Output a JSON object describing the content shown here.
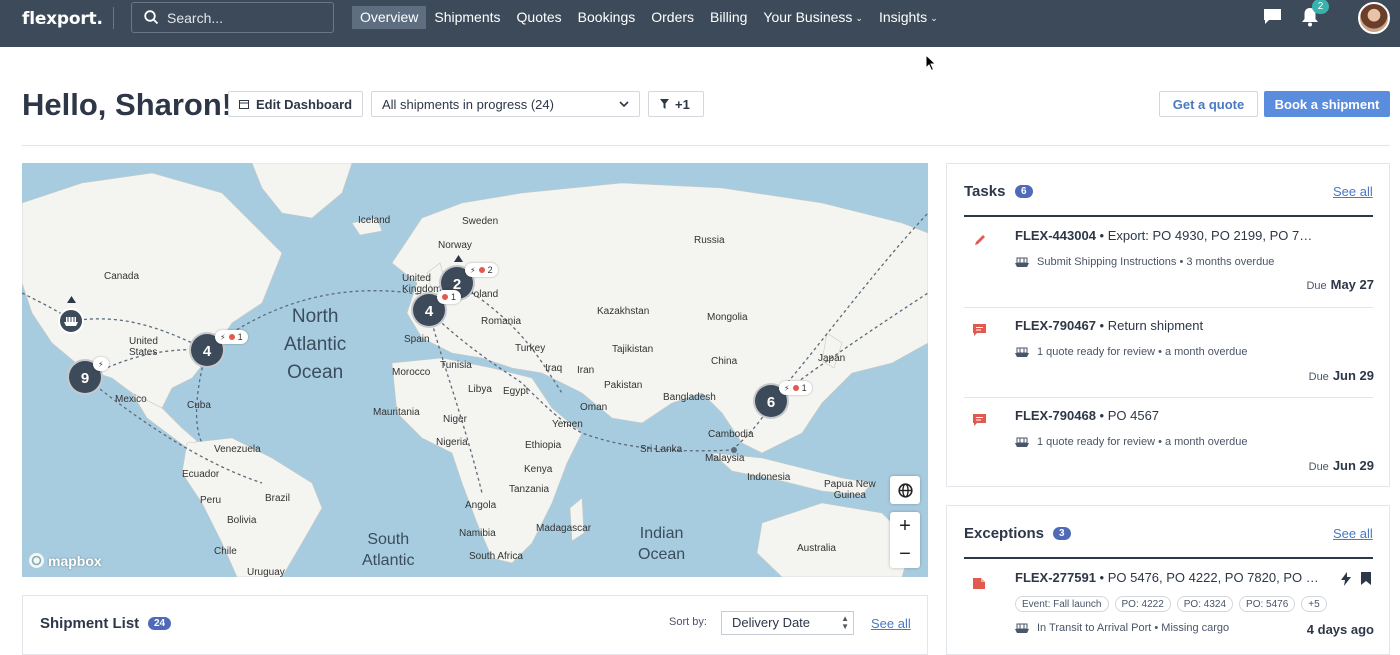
{
  "nav": {
    "logo": "flexport.",
    "search_placeholder": "Search...",
    "links": [
      {
        "label": "Overview",
        "active": true
      },
      {
        "label": "Shipments"
      },
      {
        "label": "Quotes"
      },
      {
        "label": "Bookings"
      },
      {
        "label": "Orders"
      },
      {
        "label": "Billing"
      },
      {
        "label": "Your Business",
        "dropdown": true
      },
      {
        "label": "Insights",
        "dropdown": true
      }
    ],
    "notification_count": "2"
  },
  "header": {
    "greeting": "Hello, Sharon!",
    "edit_dashboard": "Edit Dashboard",
    "shipment_filter": "All shipments in progress (24)",
    "extra_filters": "+1",
    "get_quote": "Get a quote",
    "book_shipment": "Book a shipment"
  },
  "map": {
    "oceans": {
      "north_atlantic": "North\nAtlantic\nOcean",
      "south_atlantic": "South\nAtlantic",
      "indian": "Indian\nOcean"
    },
    "labels": {
      "iceland": "Iceland",
      "sweden": "Sweden",
      "norway": "Norway",
      "russia": "Russia",
      "canada": "Canada",
      "united_states": "United\nStates",
      "united_kingdom": "United\nKingdom",
      "poland": "Poland",
      "romania": "Romania",
      "kazakhstan": "Kazakhstan",
      "mongolia": "Mongolia",
      "spain": "Spain",
      "turkey": "Turkey",
      "tajikistan": "Tajikistan",
      "china": "China",
      "japan": "Japan",
      "morocco": "Morocco",
      "tunisia": "Tunisia",
      "iraq": "Iraq",
      "iran": "Iran",
      "pakistan": "Pakistan",
      "mexico": "Mexico",
      "cuba": "Cuba",
      "libya": "Libya",
      "egypt": "Egypt",
      "oman": "Oman",
      "bangladesh": "Bangladesh",
      "mauritania": "Mauritania",
      "niger": "Niger",
      "yemen": "Yemen",
      "nigeria": "Nigeria",
      "ethiopia": "Ethiopia",
      "sri_lanka": "Sri Lanka",
      "cambodia": "Cambodia",
      "malaysia": "Malaysia",
      "venezuela": "Venezuela",
      "kenya": "Kenya",
      "indonesia": "Indonesia",
      "ecuador": "Ecuador",
      "tanzania": "Tanzania",
      "papua": "Papua New\nGuinea",
      "brazil": "Brazil",
      "peru": "Peru",
      "angola": "Angola",
      "bolivia": "Bolivia",
      "madagascar": "Madagascar",
      "namibia": "Namibia",
      "australia": "Australia",
      "chile": "Chile",
      "south_africa": "South Africa",
      "uruguay": "Uruguay"
    },
    "clusters": [
      {
        "id": "europe-north",
        "count": "2",
        "alerts": "2"
      },
      {
        "id": "europe-west",
        "count": "4",
        "alerts": "1"
      },
      {
        "id": "us-east",
        "count": "4",
        "alerts": "1"
      },
      {
        "id": "us-west",
        "count": "9"
      },
      {
        "id": "asia-east",
        "count": "6",
        "alerts": "1"
      }
    ],
    "attribution": "mapbox"
  },
  "shipment_list": {
    "title": "Shipment List",
    "count": "24",
    "sort_label": "Sort by:",
    "sort_value": "Delivery Date",
    "see_all": "See all"
  },
  "tasks": {
    "title": "Tasks",
    "count": "6",
    "see_all": "See all",
    "items": [
      {
        "id": "FLEX-443004",
        "desc": " • Export: PO 4930, PO 2199, PO 7…",
        "sub": "Submit Shipping Instructions • 3 months overdue",
        "due_label": "Due",
        "due_date": "May 27"
      },
      {
        "id": "FLEX-790467",
        "desc": " • Return shipment",
        "sub": "1 quote ready for review • a month overdue",
        "due_label": "Due",
        "due_date": "Jun 29"
      },
      {
        "id": "FLEX-790468",
        "desc": " • PO 4567",
        "sub": "1 quote ready for review • a month overdue",
        "due_label": "Due",
        "due_date": "Jun 29"
      }
    ]
  },
  "exceptions": {
    "title": "Exceptions",
    "count": "3",
    "see_all": "See all",
    "items": [
      {
        "id": "FLEX-277591",
        "desc": " • PO 5476, PO 4222, PO 7820, PO …",
        "tags": [
          "Event: Fall launch",
          "PO: 4222",
          "PO: 4324",
          "PO: 5476",
          "+5"
        ],
        "sub": "In Transit to Arrival Port • Missing cargo",
        "ago": "4 days ago"
      }
    ]
  },
  "colors": {
    "nav_bg": "#3d4a59",
    "accent": "#5b8ddf",
    "badge": "#4f6bb8",
    "water": "#a8ccdf",
    "land": "#f4f4f1",
    "alert": "#e05a4f"
  }
}
